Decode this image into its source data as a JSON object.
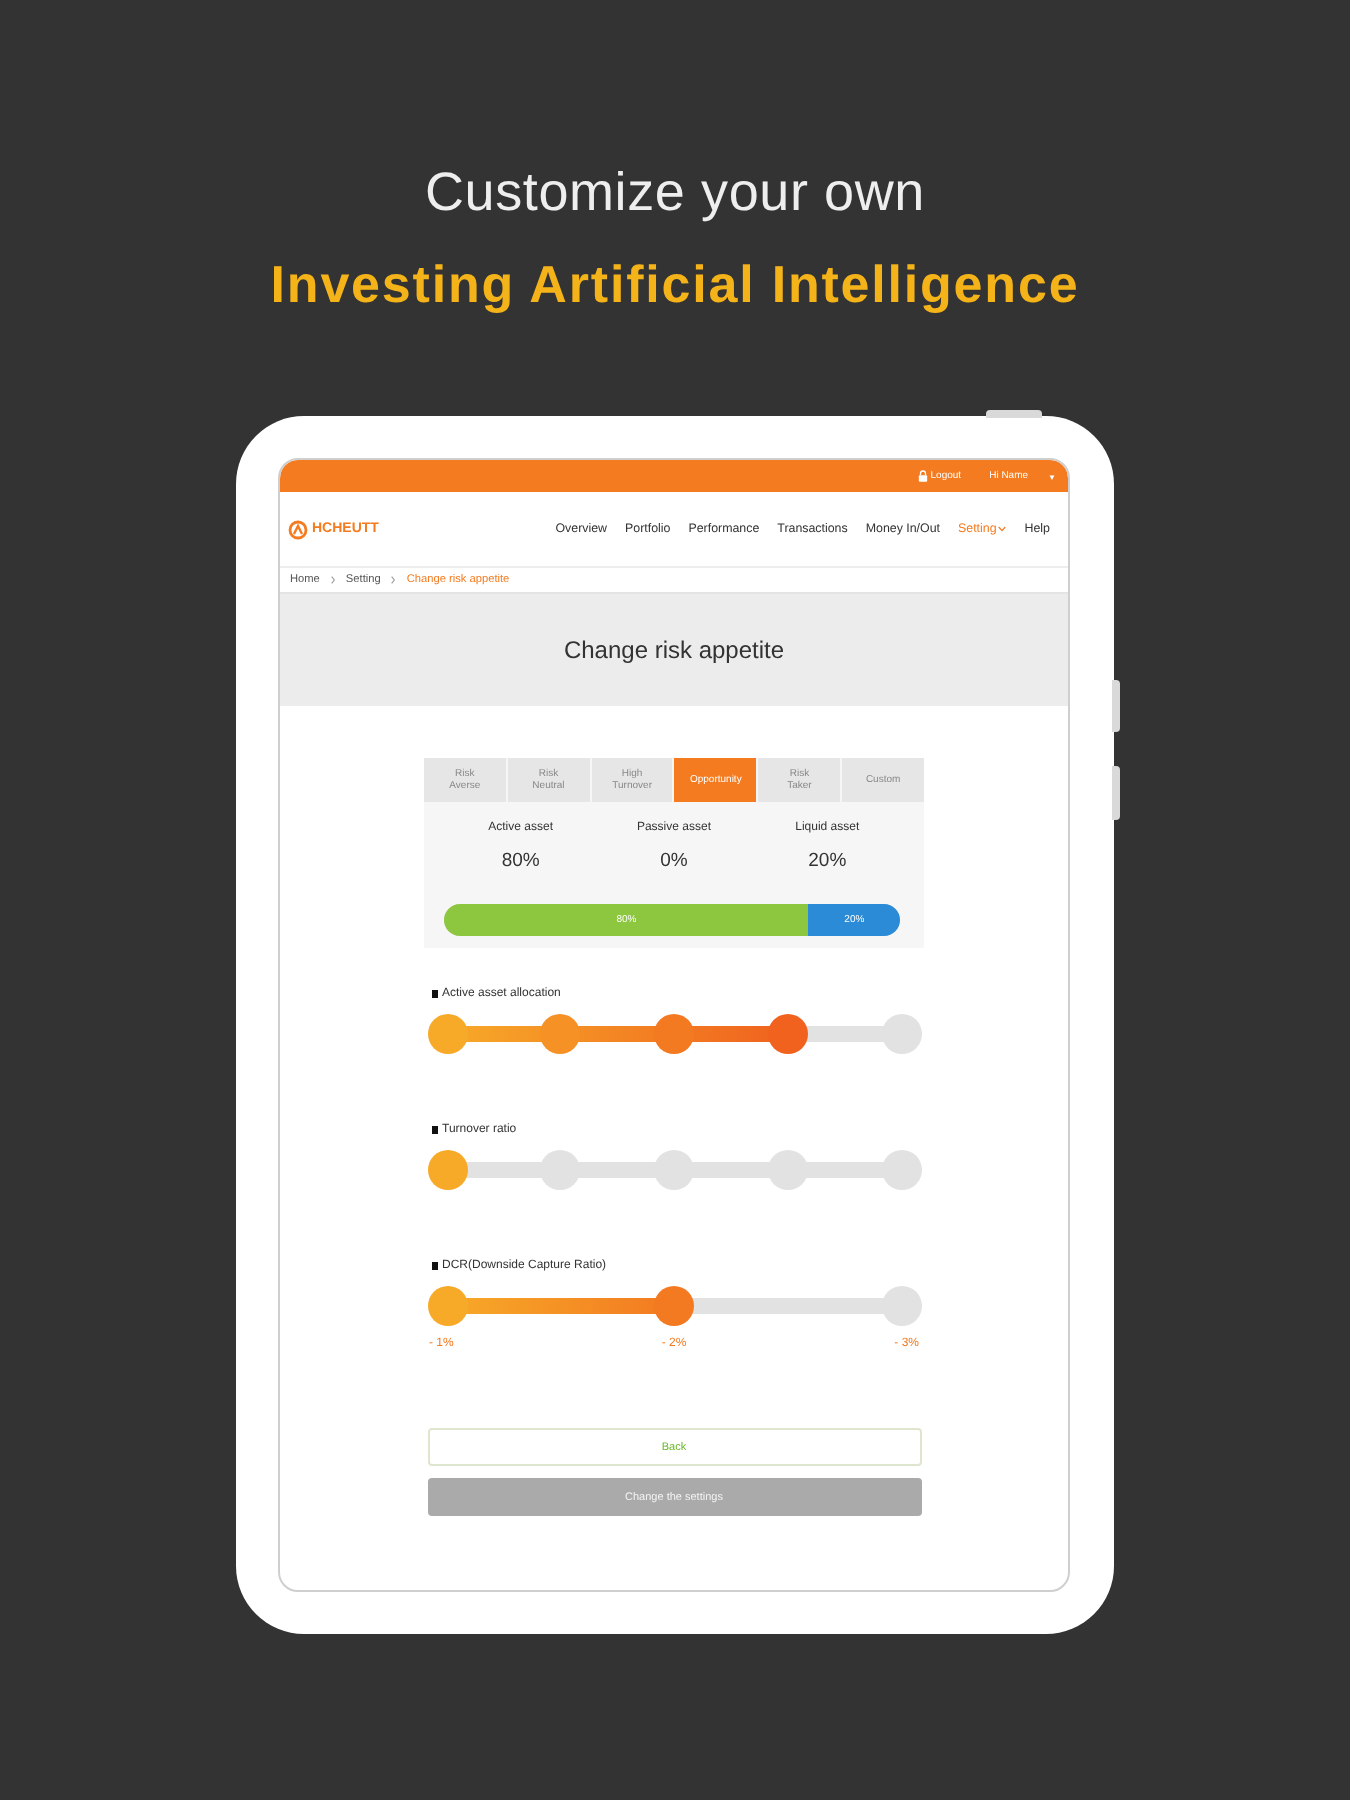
{
  "headline": {
    "title": "Customize your own",
    "accent": "Investing Artificial Intelligence"
  },
  "top_bar": {
    "logout": "Logout",
    "user": "Hi Name",
    "menu_caret": "▼"
  },
  "header": {
    "logo": "HCHEUTT",
    "nav": [
      {
        "label": "Overview",
        "selected": false,
        "dropdown": false
      },
      {
        "label": "Portfolio",
        "selected": false,
        "dropdown": false
      },
      {
        "label": "Performance",
        "selected": false,
        "dropdown": false
      },
      {
        "label": "Transactions",
        "selected": false,
        "dropdown": false
      },
      {
        "label": "Money In/Out",
        "selected": false,
        "dropdown": false
      },
      {
        "label": "Setting",
        "selected": true,
        "dropdown": true
      },
      {
        "label": "Help",
        "selected": false,
        "dropdown": false
      }
    ]
  },
  "breadcrumb": [
    {
      "label": "Home",
      "current": false
    },
    {
      "label": "Setting",
      "current": false
    },
    {
      "label": "Change risk appetite",
      "current": true
    }
  ],
  "page_title": "Change risk appetite",
  "risk_tabs": [
    {
      "label": "Risk\nAverse",
      "selected": false
    },
    {
      "label": "Risk\nNeutral",
      "selected": false
    },
    {
      "label": "High\nTurnover",
      "selected": false
    },
    {
      "label": "Opportunity",
      "selected": true
    },
    {
      "label": "Risk\nTaker",
      "selected": false
    },
    {
      "label": "Custom",
      "selected": false
    }
  ],
  "assets": [
    {
      "name": "Active asset",
      "value": "80%"
    },
    {
      "name": "Passive asset",
      "value": "0%"
    },
    {
      "name": "Liquid asset",
      "value": "20%"
    }
  ],
  "allocation_bar": [
    {
      "label": "80%",
      "level": 0.8,
      "color": "#8dc63f"
    },
    {
      "label": "20%",
      "level": 0.2,
      "color": "#2b8bd6"
    }
  ],
  "sliders": [
    {
      "label": "Active asset allocation",
      "level": 0.75
    },
    {
      "label": "Turnover ratio",
      "level": 0
    },
    {
      "label": "DCR(Downside Capture Ratio)",
      "level": 0.5,
      "tick_labels": [
        "- 1%",
        "- 2%",
        "- 3%"
      ]
    }
  ],
  "buttons": [
    {
      "label": "Back",
      "kind": "outline",
      "disabled": false
    },
    {
      "label": "Change the settings",
      "kind": "solid",
      "disabled": true
    }
  ]
}
